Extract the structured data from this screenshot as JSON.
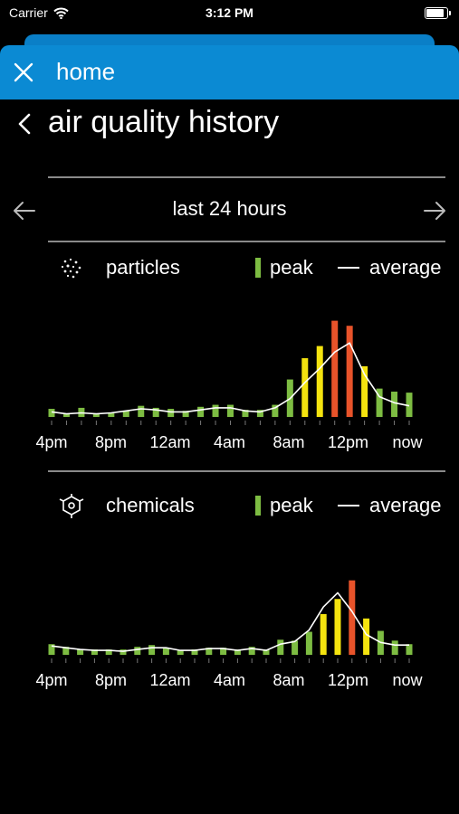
{
  "status_bar": {
    "carrier": "Carrier",
    "time": "3:12 PM",
    "wifi_icon": "wifi-icon",
    "battery_icon": "battery-icon"
  },
  "nav": {
    "title": "home",
    "close_icon": "close-icon"
  },
  "page": {
    "title": "air quality history",
    "back_icon": "chevron-left-icon"
  },
  "range": {
    "label": "last 24 hours",
    "prev_icon": "arrow-left-icon",
    "next_icon": "arrow-right-icon"
  },
  "legend": {
    "peak_label": "peak",
    "average_label": "average"
  },
  "colors": {
    "nav": "#0b8ad3",
    "good": "#7dbc42",
    "moderate": "#f4e30f",
    "high": "#e8532a",
    "average_line": "#ffffff"
  },
  "chart_data": [
    {
      "type": "bar",
      "title": "particles",
      "icon": "particles-icon",
      "x_tick_labels": [
        "4pm",
        "8pm",
        "12am",
        "4am",
        "8am",
        "12pm",
        "now"
      ],
      "series": [
        {
          "name": "peak",
          "values": [
            8,
            3,
            9,
            3,
            4,
            6,
            11,
            9,
            8,
            6,
            10,
            12,
            12,
            7,
            7,
            12,
            37,
            58,
            70,
            95,
            90,
            50,
            28,
            25,
            24
          ]
        },
        {
          "name": "average",
          "values": [
            5,
            3,
            4,
            3,
            4,
            6,
            8,
            7,
            5,
            5,
            7,
            9,
            9,
            6,
            5,
            9,
            18,
            34,
            48,
            64,
            73,
            42,
            20,
            14,
            11
          ]
        }
      ],
      "levels": [
        "good",
        "good",
        "good",
        "good",
        "good",
        "good",
        "good",
        "good",
        "good",
        "good",
        "good",
        "good",
        "good",
        "good",
        "good",
        "good",
        "good",
        "moderate",
        "moderate",
        "high",
        "high",
        "moderate",
        "good",
        "good",
        "good"
      ],
      "ylim": [
        0,
        100
      ]
    },
    {
      "type": "bar",
      "title": "chemicals",
      "icon": "chemicals-icon",
      "x_tick_labels": [
        "4pm",
        "8pm",
        "12am",
        "4am",
        "8am",
        "12pm",
        "now"
      ],
      "series": [
        {
          "name": "peak",
          "values": [
            12,
            9,
            6,
            6,
            6,
            6,
            9,
            11,
            8,
            5,
            6,
            8,
            8,
            6,
            9,
            6,
            17,
            16,
            26,
            46,
            63,
            84,
            41,
            27,
            16,
            12
          ]
        },
        {
          "name": "average",
          "values": [
            10,
            8,
            6,
            5,
            5,
            4,
            6,
            8,
            8,
            5,
            5,
            7,
            7,
            5,
            7,
            5,
            12,
            15,
            28,
            54,
            70,
            49,
            23,
            14,
            11,
            11
          ]
        }
      ],
      "levels": [
        "good",
        "good",
        "good",
        "good",
        "good",
        "good",
        "good",
        "good",
        "good",
        "good",
        "good",
        "good",
        "good",
        "good",
        "good",
        "good",
        "good",
        "good",
        "good",
        "moderate",
        "moderate",
        "high",
        "moderate",
        "good",
        "good",
        "good"
      ],
      "ylim": [
        0,
        100
      ]
    }
  ]
}
